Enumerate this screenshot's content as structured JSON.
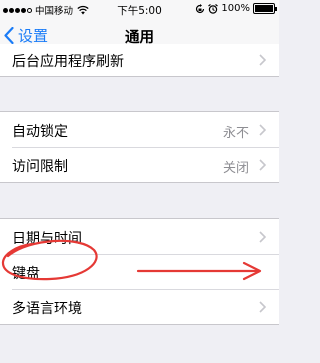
{
  "status_bar": {
    "carrier": "中国移动",
    "time": "下午5:00",
    "battery": "100%",
    "battery_level": 1.0,
    "signal_bars_filled": 4,
    "signal_bars_total": 5
  },
  "nav": {
    "back_label": "设置",
    "title": "通用"
  },
  "groups": {
    "top": {
      "items": [
        {
          "label": "后台应用程序刷新"
        }
      ]
    },
    "lock": {
      "items": [
        {
          "label": "自动锁定",
          "value": "永不"
        },
        {
          "label": "访问限制",
          "value": "关闭"
        }
      ]
    },
    "intl": {
      "items": [
        {
          "label": "日期与时间"
        },
        {
          "label": "键盘"
        },
        {
          "label": "多语言环境"
        }
      ]
    }
  },
  "colors": {
    "accent": "#1a7cf7",
    "annotation": "#e53935",
    "background": "#efeff4"
  },
  "icons": [
    "wifi-icon",
    "lock-rotation-icon",
    "alarm-icon",
    "battery-icon",
    "back-chevron-icon",
    "chevron-right-icon"
  ]
}
